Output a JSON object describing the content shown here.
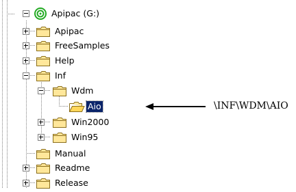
{
  "tree": {
    "items": [
      {
        "label": "Apipac (G:)",
        "icon": "cd-drive-icon",
        "expander": "minus"
      },
      {
        "label": "Apipac",
        "icon": "folder-icon",
        "expander": "plus"
      },
      {
        "label": "FreeSamples",
        "icon": "folder-icon",
        "expander": "plus"
      },
      {
        "label": "Help",
        "icon": "folder-icon",
        "expander": "plus"
      },
      {
        "label": "Inf",
        "icon": "folder-icon",
        "expander": "minus"
      },
      {
        "label": "Wdm",
        "icon": "folder-icon",
        "expander": "minus"
      },
      {
        "label": "Aio",
        "icon": "open-folder-icon",
        "expander": "none",
        "selected": true
      },
      {
        "label": "Win2000",
        "icon": "folder-icon",
        "expander": "plus"
      },
      {
        "label": "Win95",
        "icon": "folder-icon",
        "expander": "plus"
      },
      {
        "label": "Manual",
        "icon": "folder-icon",
        "expander": "none"
      },
      {
        "label": "Readme",
        "icon": "folder-icon",
        "expander": "plus"
      },
      {
        "label": "Release",
        "icon": "folder-icon",
        "expander": "plus"
      }
    ]
  },
  "annotation": {
    "text": "\\INF\\WDM\\AIO",
    "icon": "arrow-left-icon"
  },
  "colors": {
    "selection": "#0a246a",
    "folder_fill": "#ffe79a",
    "folder_stroke": "#8a6d1a",
    "drive_green": "#22aa22",
    "tree_lines": "#808080"
  }
}
